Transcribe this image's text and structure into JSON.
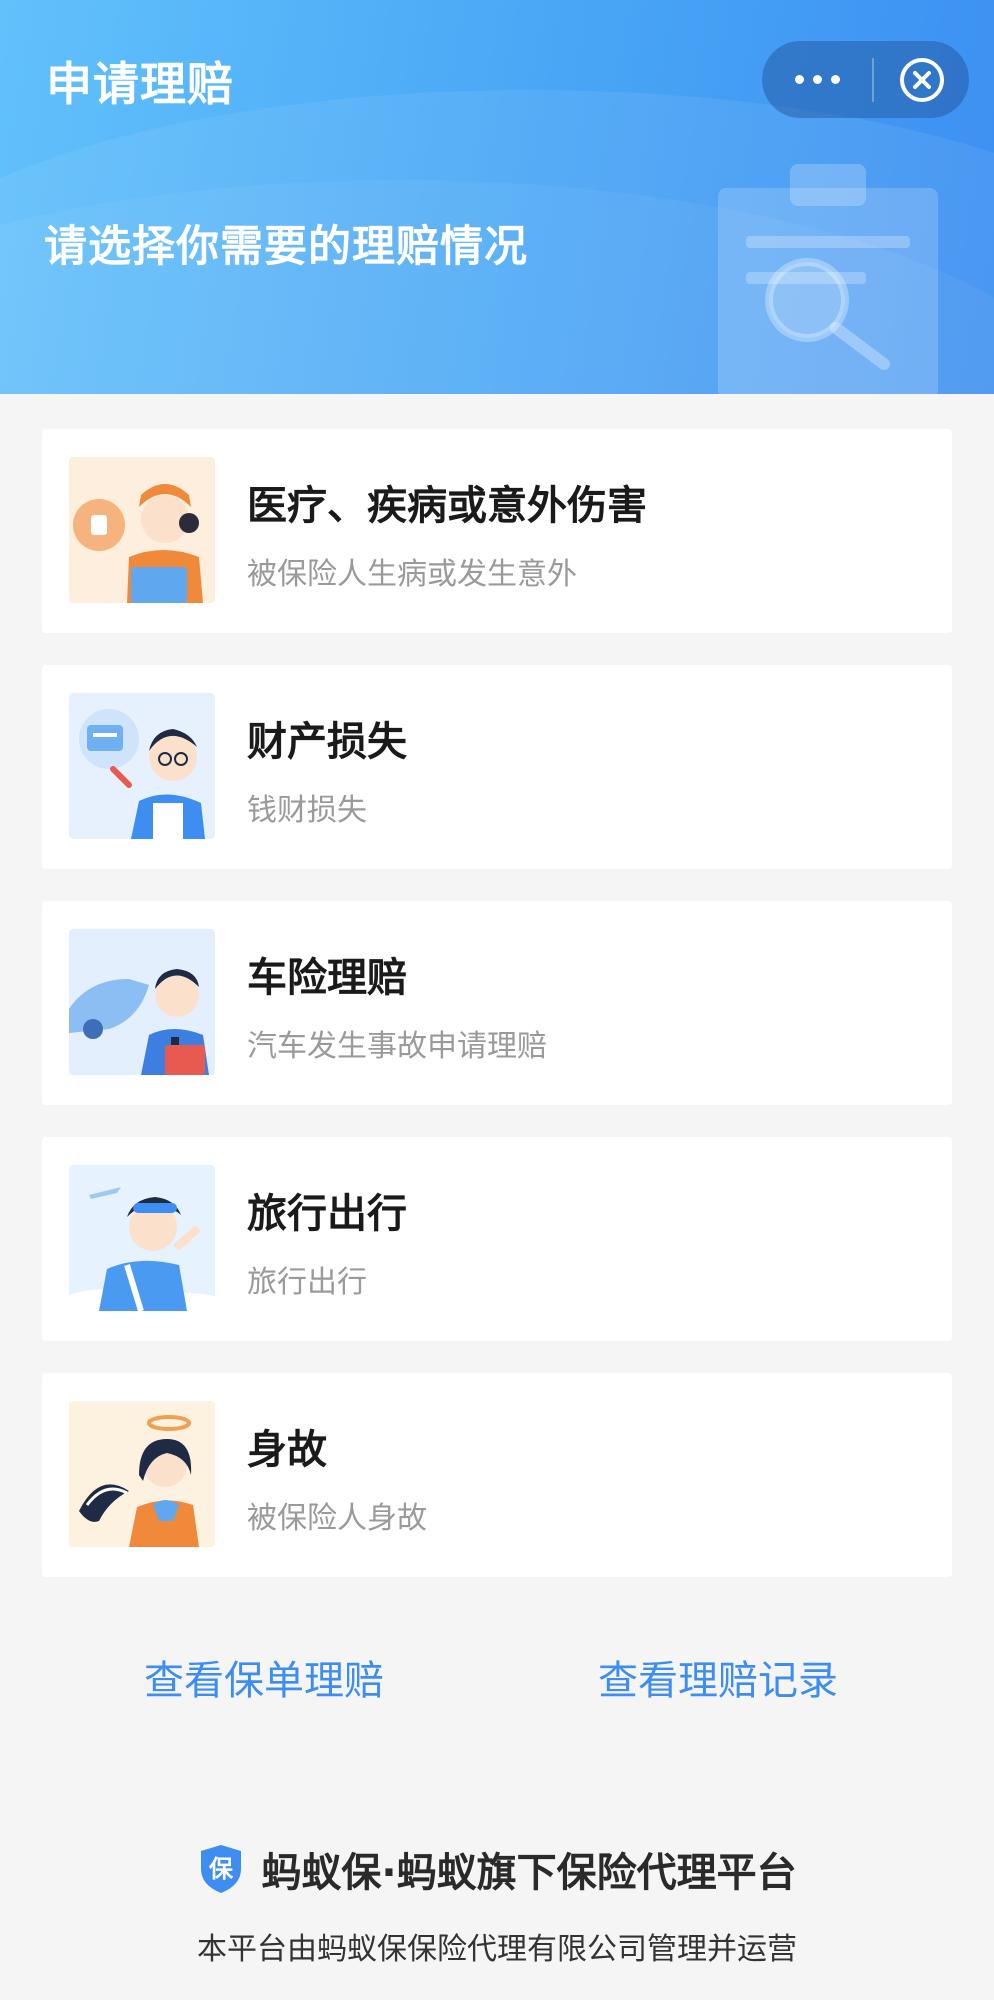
{
  "header": {
    "title": "申请理赔",
    "subtitle": "请选择你需要的理赔情况",
    "more_icon": "more-dots-icon",
    "close_icon": "close-circle-icon",
    "bg_colors": [
      "#62c1fb",
      "#3c8ff2"
    ]
  },
  "claim_options": [
    {
      "title": "医疗、疾病或意外伤害",
      "desc": "被保险人生病或发生意外",
      "illustration": "doctor-illustration"
    },
    {
      "title": "财产损失",
      "desc": "钱财损失",
      "illustration": "money-loss-illustration"
    },
    {
      "title": "车险理赔",
      "desc": "汽车发生事故申请理赔",
      "illustration": "car-insurance-illustration"
    },
    {
      "title": "旅行出行",
      "desc": "旅行出行",
      "illustration": "travel-illustration"
    },
    {
      "title": "身故",
      "desc": "被保险人身故",
      "illustration": "angel-illustration"
    }
  ],
  "links": {
    "policy_claims": "查看保单理赔",
    "claim_records": "查看理赔记录",
    "color": "#3d8ef0"
  },
  "footer": {
    "shield_char": "保",
    "brand": "蚂蚁保·蚂蚁旗下保险代理平台",
    "note": "本平台由蚂蚁保保险代理有限公司管理并运营"
  }
}
